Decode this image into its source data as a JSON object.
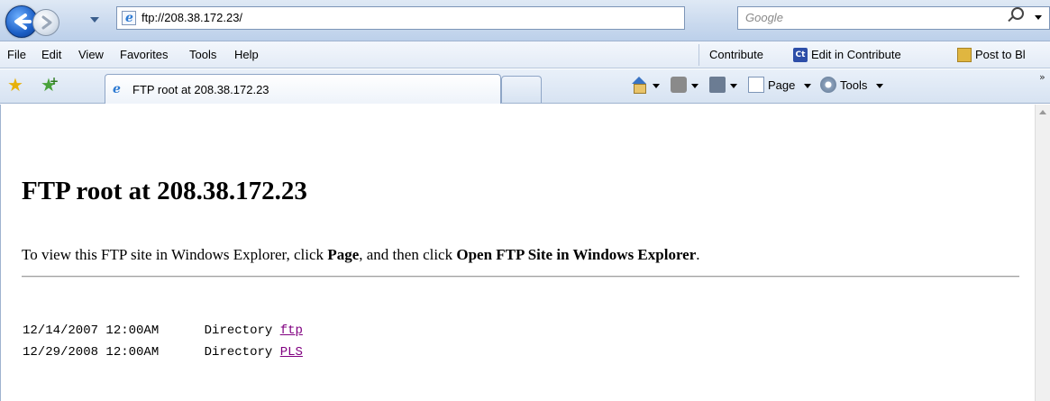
{
  "address_bar": {
    "url": "ftp://208.38.172.23/",
    "search_placeholder": "Google"
  },
  "menu": {
    "items": [
      "File",
      "Edit",
      "View",
      "Favorites",
      "Tools",
      "Help"
    ],
    "contribute": "Contribute",
    "edit_in_contribute": "Edit in Contribute",
    "contribute_icon_text": "Ct",
    "post_to_blog": "Post to Bl"
  },
  "tabs": {
    "active_title": "FTP root at 208.38.172.23"
  },
  "commands": {
    "page": "Page",
    "tools": "Tools",
    "overflow": "»"
  },
  "page": {
    "heading": "FTP root at 208.38.172.23",
    "instructions": {
      "before": "To view this FTP site in Windows Explorer, click ",
      "page_word": "Page",
      "middle": ", and then click ",
      "open_phrase": "Open FTP Site in Windows Explorer",
      "end": "."
    },
    "entries": [
      {
        "date": "12/14/2007 12:00AM",
        "type": "Directory",
        "name": "ftp"
      },
      {
        "date": "12/29/2008 12:00AM",
        "type": "Directory",
        "name": "PLS"
      }
    ]
  },
  "colors": {
    "link_visited": "#800080",
    "chrome_blue": "#c9d9ee"
  }
}
